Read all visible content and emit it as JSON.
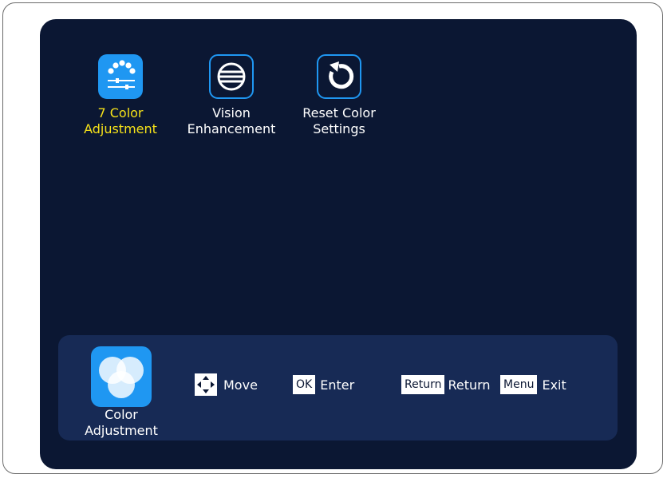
{
  "menu": {
    "items": [
      {
        "label_line1": "7 Color",
        "label_line2": "Adjustment",
        "icon": "color-sliders-icon",
        "selected": true
      },
      {
        "label_line1": "Vision",
        "label_line2": "Enhancement",
        "icon": "vision-enhance-icon",
        "selected": false
      },
      {
        "label_line1": "Reset Color",
        "label_line2": "Settings",
        "icon": "reset-icon",
        "selected": false
      }
    ]
  },
  "current": {
    "label_line1": "Color",
    "label_line2": "Adjustment",
    "icon": "color-circles-icon"
  },
  "hints": {
    "move_label": "Move",
    "ok_key": "OK",
    "ok_label": "Enter",
    "return_key": "Return",
    "return_label": "Return",
    "menu_key": "Menu",
    "menu_label": "Exit"
  },
  "colors": {
    "background": "#0b1733",
    "panel": "#172a55",
    "accent": "#1f97f2",
    "selected_text": "#f6e219"
  }
}
